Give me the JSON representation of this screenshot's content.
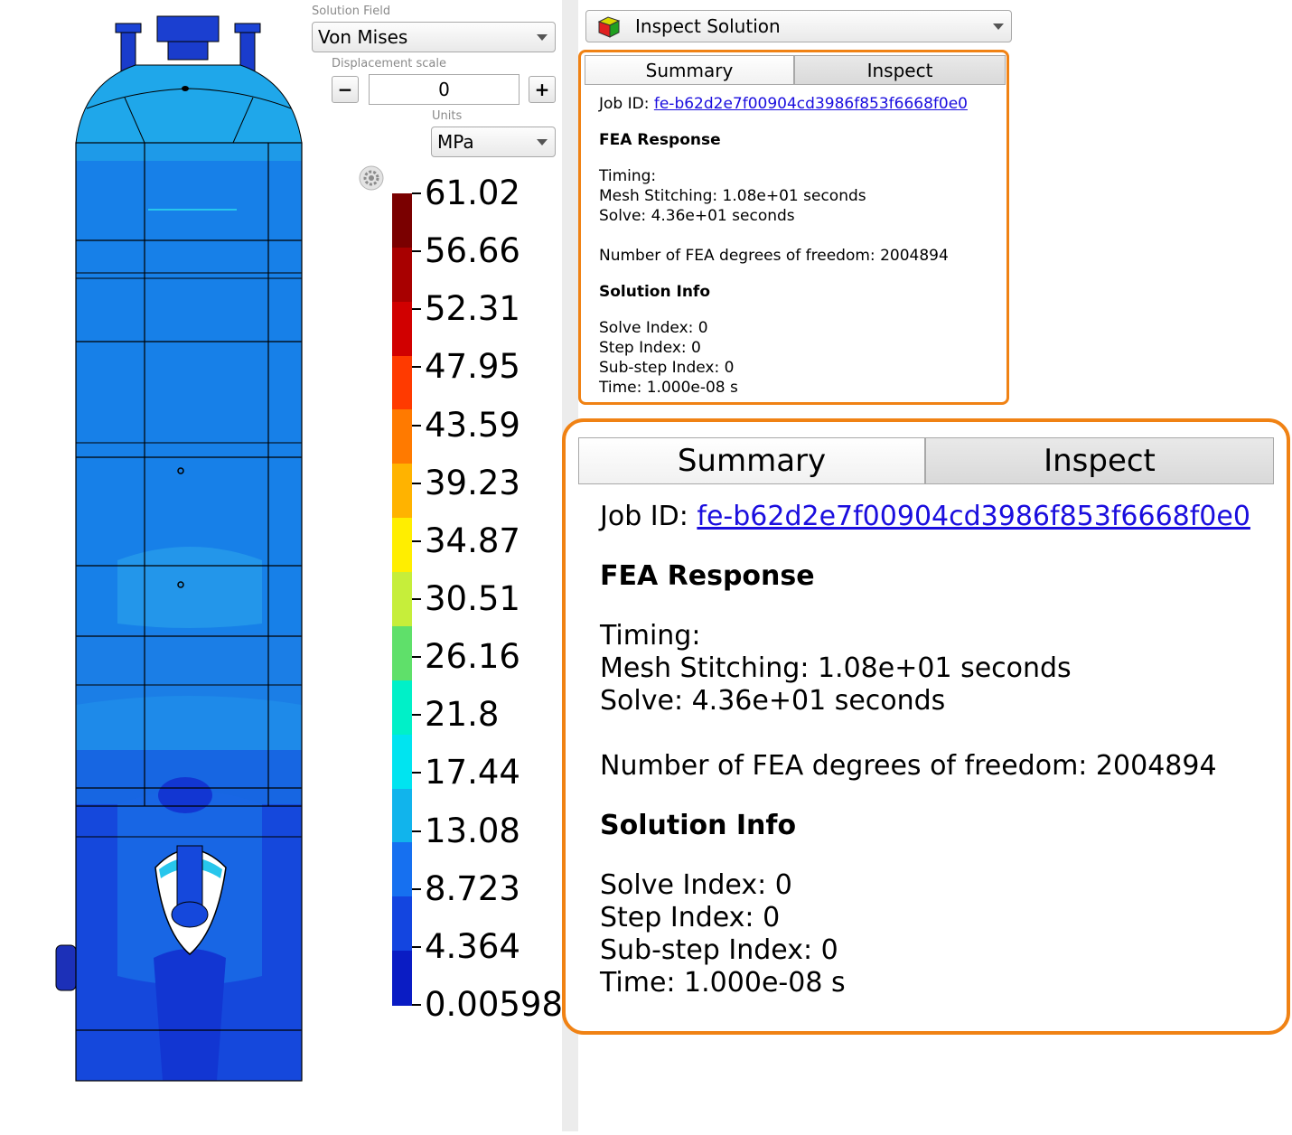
{
  "solution_field": {
    "label": "Solution Field",
    "value": "Von Mises"
  },
  "displacement_scale": {
    "label": "Displacement scale",
    "minus": "−",
    "value": "0",
    "plus": "+"
  },
  "units": {
    "label": "Units",
    "value": "MPa"
  },
  "legend": {
    "tick_labels": [
      "61.02",
      "56.66",
      "52.31",
      "47.95",
      "43.59",
      "39.23",
      "34.87",
      "30.51",
      "26.16",
      "21.8",
      "17.44",
      "13.08",
      "8.723",
      "4.364",
      "0.00598"
    ],
    "colors": [
      "#7a0000",
      "#a80000",
      "#d10000",
      "#ff3a00",
      "#ff7a00",
      "#ffb300",
      "#ffee00",
      "#c6ee3a",
      "#5fe06a",
      "#00f0c8",
      "#00e4f0",
      "#11b4ec",
      "#1670f0",
      "#1345e0",
      "#0a1cc4"
    ]
  },
  "inspect_dropdown": {
    "label": "Inspect Solution"
  },
  "tabs": {
    "summary": "Summary",
    "inspect": "Inspect"
  },
  "summary": {
    "job_id_label": "Job ID:",
    "job_id": "fe-b62d2e7f00904cd3986f853f6668f0e0",
    "fea_heading": "FEA Response",
    "timing_label": "Timing:",
    "mesh_stitching": "Mesh Stitching: 1.08e+01 seconds",
    "solve_time": "Solve: 4.36e+01 seconds",
    "dof": "Number of FEA degrees of freedom: 2004894",
    "solution_heading": "Solution Info",
    "solve_index": "Solve Index: 0",
    "step_index": "Step Index: 0",
    "substep_index": "Sub-step Index: 0",
    "time": "Time: 1.000e-08 s"
  },
  "colors": {
    "highlight_border": "#f08214",
    "link": "#1a0dde"
  }
}
